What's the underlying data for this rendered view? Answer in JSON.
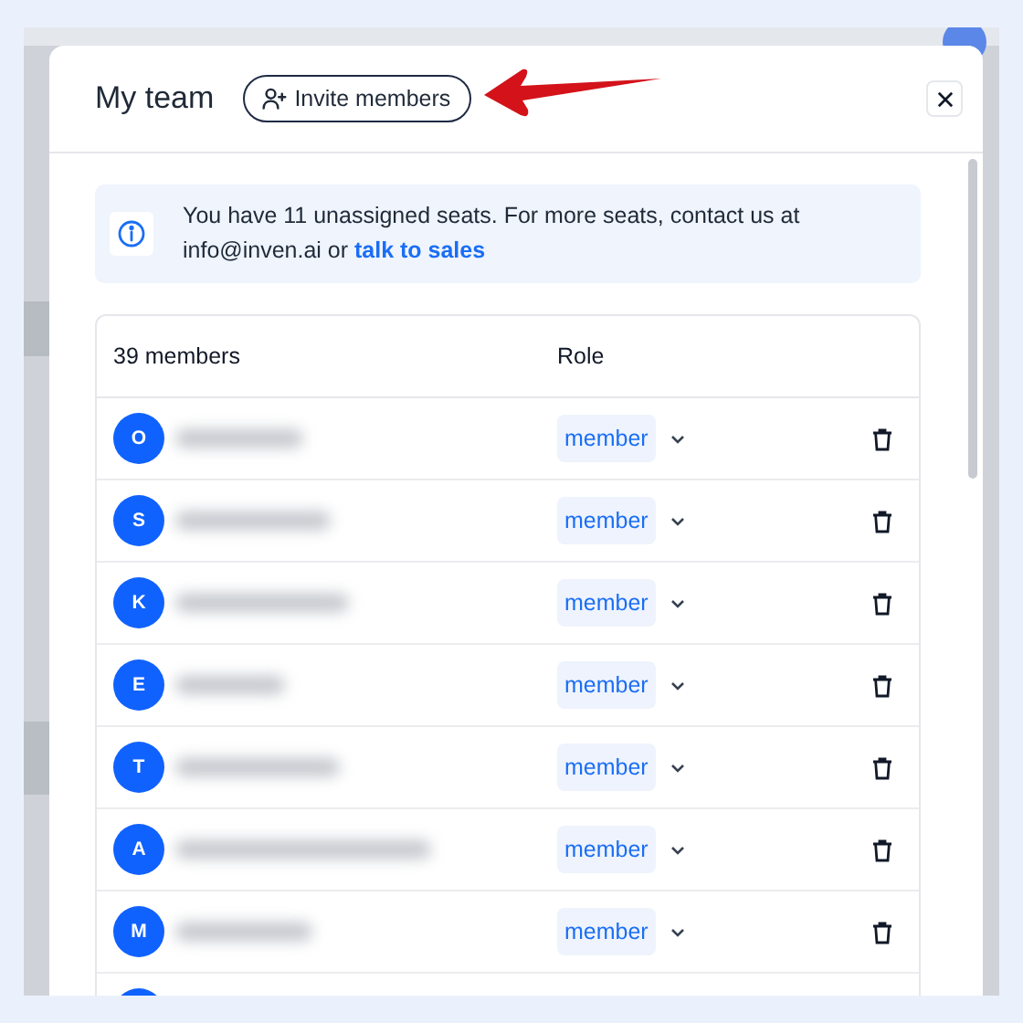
{
  "header": {
    "title": "My team",
    "invite_button": "Invite members"
  },
  "banner": {
    "text": "You have 11 unassigned seats. For more seats, contact us at info@inven.ai or",
    "link": "talk to sales"
  },
  "table": {
    "columns": [
      "39 members",
      "Role"
    ],
    "rows": [
      {
        "initial": "O",
        "role": "member"
      },
      {
        "initial": "S",
        "role": "member"
      },
      {
        "initial": "K",
        "role": "member"
      },
      {
        "initial": "E",
        "role": "member"
      },
      {
        "initial": "T",
        "role": "member"
      },
      {
        "initial": "A",
        "role": "member"
      },
      {
        "initial": "M",
        "role": "member"
      }
    ],
    "more_rows_below": true
  }
}
